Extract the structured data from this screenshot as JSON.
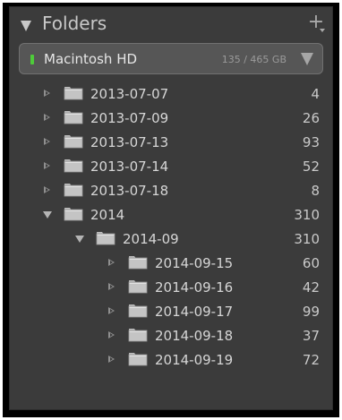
{
  "panel": {
    "title": "Folders",
    "add_label": "+",
    "add_icon": "plus-icon",
    "colors": {
      "background": "#3b3b3b",
      "text": "#d6d6d6",
      "online_indicator": "#4ecb3a"
    }
  },
  "volume": {
    "name": "Macintosh HD",
    "usage": "135 / 465 GB",
    "status": "online"
  },
  "folders": [
    {
      "name": "2013-07-07",
      "count": "4",
      "level": 0,
      "expanded": false
    },
    {
      "name": "2013-07-09",
      "count": "26",
      "level": 0,
      "expanded": false
    },
    {
      "name": "2013-07-13",
      "count": "93",
      "level": 0,
      "expanded": false
    },
    {
      "name": "2013-07-14",
      "count": "52",
      "level": 0,
      "expanded": false
    },
    {
      "name": "2013-07-18",
      "count": "8",
      "level": 0,
      "expanded": false
    },
    {
      "name": "2014",
      "count": "310",
      "level": 0,
      "expanded": true
    },
    {
      "name": "2014-09",
      "count": "310",
      "level": 1,
      "expanded": true
    },
    {
      "name": "2014-09-15",
      "count": "60",
      "level": 2,
      "expanded": false
    },
    {
      "name": "2014-09-16",
      "count": "42",
      "level": 2,
      "expanded": false
    },
    {
      "name": "2014-09-17",
      "count": "99",
      "level": 2,
      "expanded": false
    },
    {
      "name": "2014-09-18",
      "count": "37",
      "level": 2,
      "expanded": false
    },
    {
      "name": "2014-09-19",
      "count": "72",
      "level": 2,
      "expanded": false
    }
  ]
}
